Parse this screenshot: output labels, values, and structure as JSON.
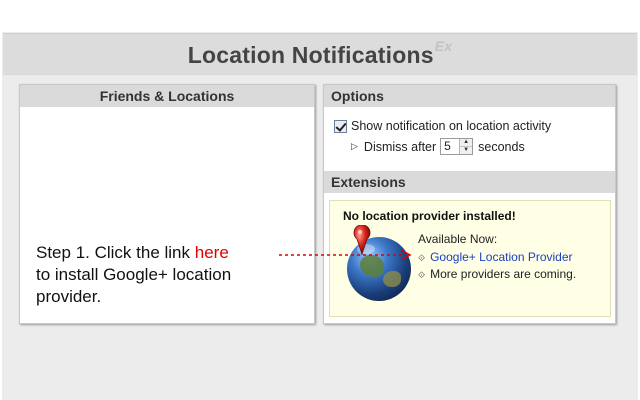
{
  "header": {
    "title": "Location Notifications",
    "title_sup": "Ex"
  },
  "friends_panel": {
    "heading": "Friends & Locations"
  },
  "options_panel": {
    "heading": "Options",
    "show_notification": {
      "checked": true,
      "label": "Show notification on location activity"
    },
    "dismiss": {
      "prefix": "Dismiss after",
      "value": "5",
      "suffix": "seconds"
    }
  },
  "extensions_panel": {
    "heading": "Extensions",
    "notice": {
      "title": "No location provider installed!",
      "available_label": "Available Now:",
      "providers": [
        {
          "label": "Google+ Location Provider",
          "link": true
        },
        {
          "label": "More providers are coming.",
          "link": false
        }
      ]
    }
  },
  "instruction": {
    "prefix": "Step 1. Click the link ",
    "link_text": "here",
    "suffix": "to install Google+ location provider."
  },
  "colors": {
    "link_blue": "#1a3fbf",
    "here_red": "#e00000",
    "notice_bg": "#ffffe6",
    "header_bg": "#dadada"
  },
  "icons": {
    "globe": "globe-with-map-pin-icon",
    "triangle": "right-triangle-icon",
    "diamond": "diamond-bullet-icon"
  }
}
